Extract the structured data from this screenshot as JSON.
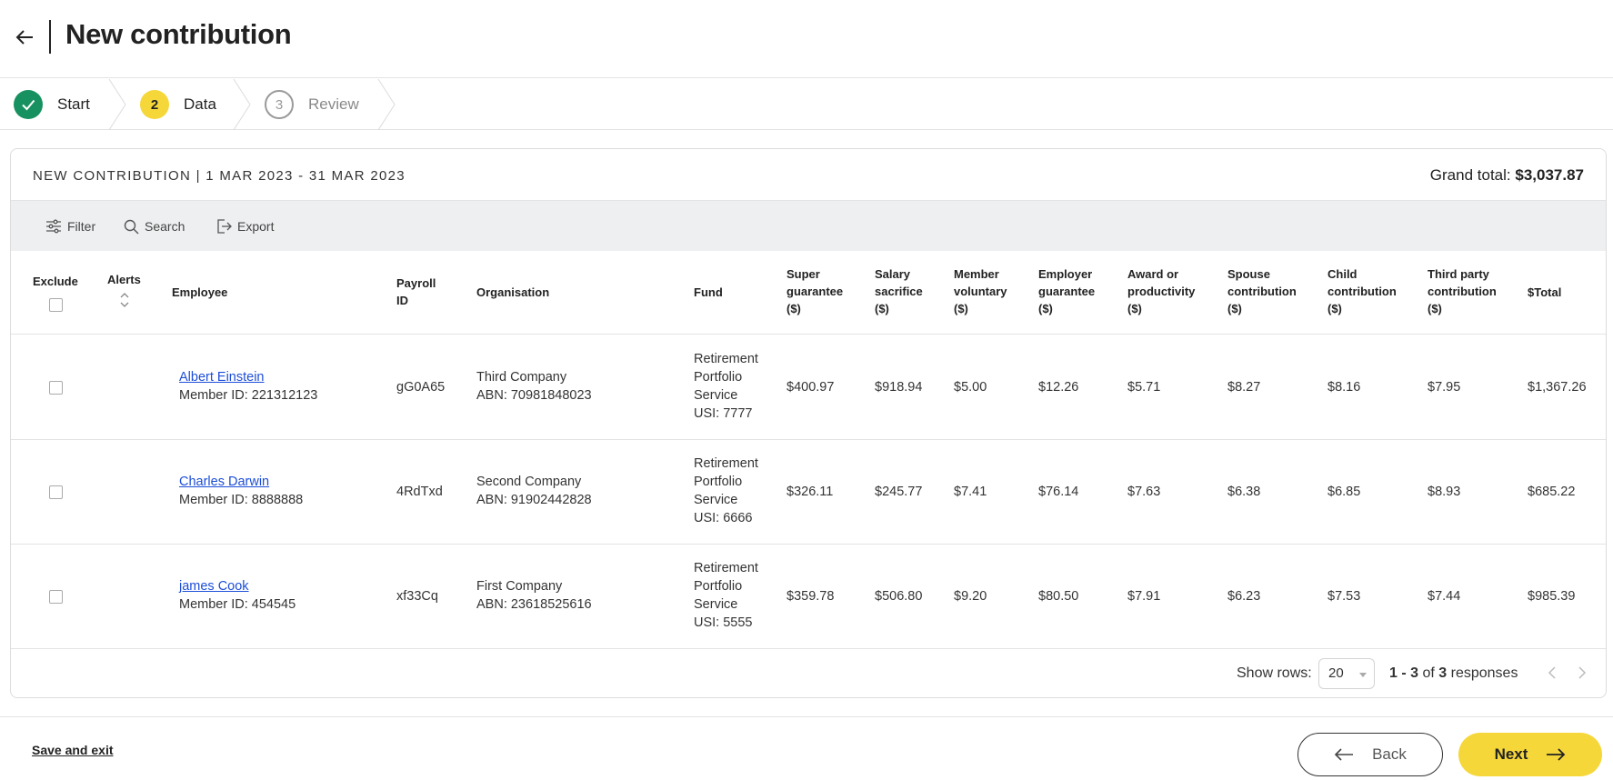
{
  "header": {
    "title": "New contribution"
  },
  "stepper": {
    "steps": [
      {
        "number": "",
        "label": "Start",
        "state": "done"
      },
      {
        "number": "2",
        "label": "Data",
        "state": "current"
      },
      {
        "number": "3",
        "label": "Review",
        "state": "future"
      }
    ]
  },
  "card": {
    "title": "NEW CONTRIBUTION | 1 MAR 2023 - 31 MAR 2023",
    "grand_total_label": "Grand total:",
    "grand_total_value": "$3,037.87"
  },
  "toolbar": {
    "filter": "Filter",
    "search": "Search",
    "export": "Export"
  },
  "table": {
    "columns": {
      "exclude": "Exclude",
      "alerts": "Alerts",
      "employee": "Employee",
      "payroll_1": "Payroll",
      "payroll_2": "ID",
      "organisation": "Organisation",
      "fund": "Fund",
      "super_1": "Super",
      "super_2": "guarantee",
      "super_3": "($)",
      "salary_1": "Salary",
      "salary_2": "sacrifice",
      "salary_3": "($)",
      "member_1": "Member",
      "member_2": "voluntary",
      "member_3": "($)",
      "employer_1": "Employer",
      "employer_2": "guarantee",
      "employer_3": "($)",
      "award_1": "Award or",
      "award_2": "productivity",
      "award_3": "($)",
      "spouse_1": "Spouse",
      "spouse_2": "contribution",
      "spouse_3": "($)",
      "child_1": "Child",
      "child_2": "contribution",
      "child_3": "($)",
      "third_1": "Third party",
      "third_2": "contribution",
      "third_3": "($)",
      "total": "$Total"
    },
    "rows": [
      {
        "name": "Albert Einstein",
        "member_id": "Member ID: 221312123",
        "payroll_id": "gG0A65",
        "org_name": "Third Company",
        "org_abn": "ABN: 70981848023",
        "fund_1": "Retirement",
        "fund_2": "Portfolio",
        "fund_3": "Service",
        "fund_usi": "USI: 7777",
        "super": "$400.97",
        "salary": "$918.94",
        "member": "$5.00",
        "employer": "$12.26",
        "award": "$5.71",
        "spouse": "$8.27",
        "child": "$8.16",
        "third": "$7.95",
        "total": "$1,367.26"
      },
      {
        "name": "Charles Darwin",
        "member_id": "Member ID: 8888888",
        "payroll_id": "4RdTxd",
        "org_name": "Second Company",
        "org_abn": "ABN: 91902442828",
        "fund_1": "Retirement",
        "fund_2": "Portfolio",
        "fund_3": "Service",
        "fund_usi": "USI: 6666",
        "super": "$326.11",
        "salary": "$245.77",
        "member": "$7.41",
        "employer": "$76.14",
        "award": "$7.63",
        "spouse": "$6.38",
        "child": "$6.85",
        "third": "$8.93",
        "total": "$685.22"
      },
      {
        "name": "james Cook",
        "member_id": "Member ID: 454545",
        "payroll_id": "xf33Cq",
        "org_name": "First Company",
        "org_abn": "ABN: 23618525616",
        "fund_1": "Retirement",
        "fund_2": "Portfolio",
        "fund_3": "Service",
        "fund_usi": "USI: 5555",
        "super": "$359.78",
        "salary": "$506.80",
        "member": "$9.20",
        "employer": "$80.50",
        "award": "$7.91",
        "spouse": "$6.23",
        "child": "$7.53",
        "third": "$7.44",
        "total": "$985.39"
      }
    ]
  },
  "pagination": {
    "show_rows_label": "Show rows:",
    "rows_value": "20",
    "range": "1 - 3",
    "of": "of",
    "count": "3",
    "responses": "responses"
  },
  "footer": {
    "save_exit": "Save and exit",
    "back": "Back",
    "next": "Next"
  },
  "colors": {
    "accent": "#f5d73a",
    "success": "#17915f",
    "link": "#1d4ed8"
  }
}
